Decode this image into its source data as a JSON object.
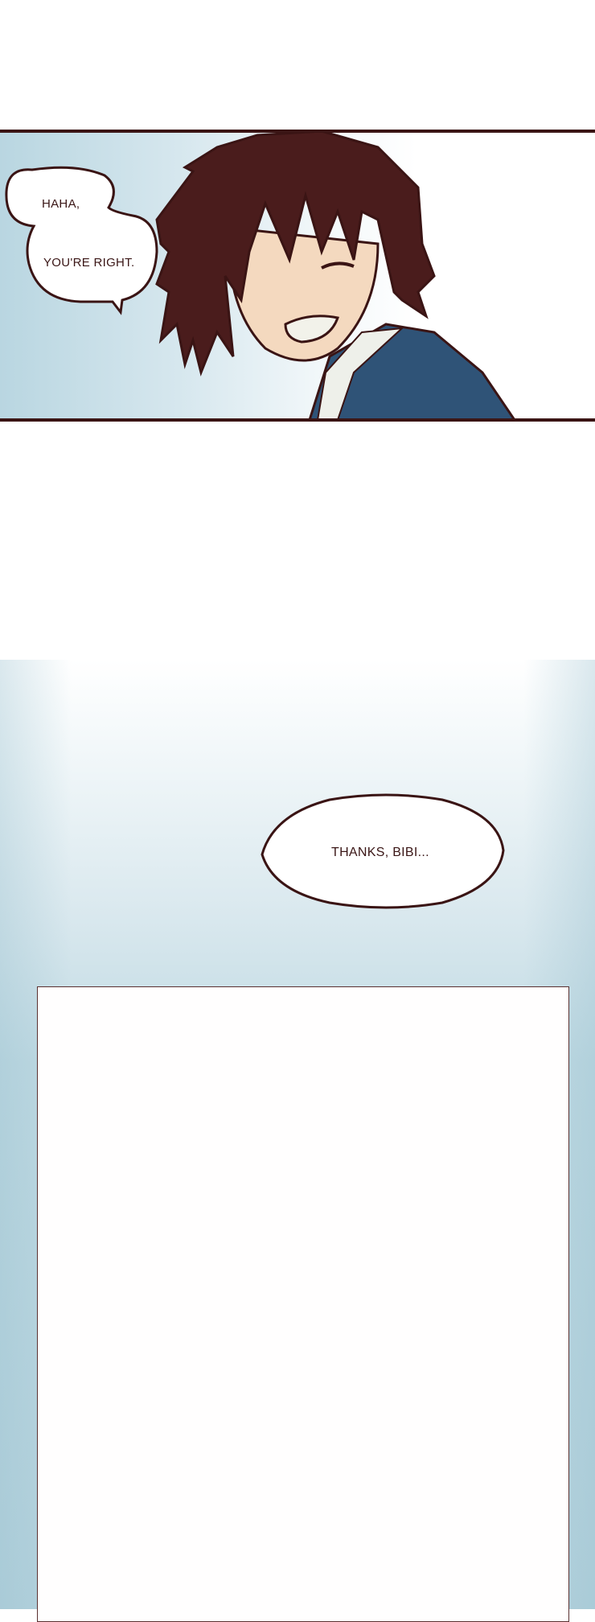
{
  "panel1": {
    "bubble": {
      "line1": "HAHA,",
      "line2": "YOU'RE RIGHT."
    }
  },
  "panel_mid": {
    "bubble": {
      "text": "THANKS, BIBI..."
    }
  },
  "colors": {
    "ink": "#3a1414",
    "hair": "#4a1c1c",
    "jacket": "#2f5377",
    "skin": "#f4d9bf",
    "sky": "#b4d2dd"
  }
}
